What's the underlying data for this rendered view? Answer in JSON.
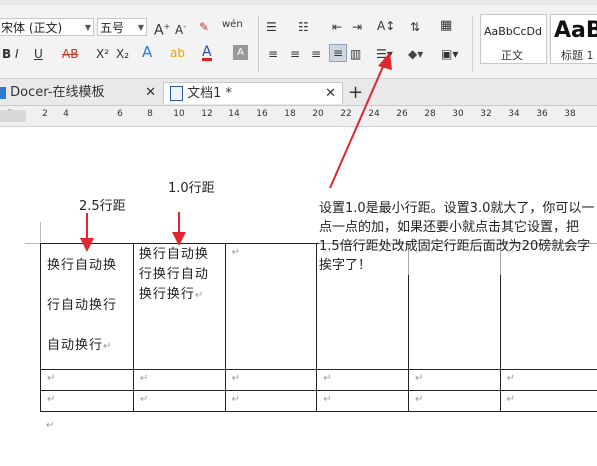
{
  "ribbon": {
    "font_name": "宋体 (正文)",
    "font_size": "五号",
    "style_previews": [
      {
        "sample": "AaBbCcDd",
        "label": "正文"
      },
      {
        "sample": "AaB",
        "label": "标题 1"
      }
    ]
  },
  "tabs": [
    {
      "label": "Docer-在线模板",
      "close": "✕"
    },
    {
      "label": "文档1 *",
      "close": "✕"
    }
  ],
  "new_tab": "+",
  "ruler": {
    "numbers": [
      "2",
      "2",
      "4",
      "6",
      "8",
      "10",
      "12",
      "14",
      "16",
      "18",
      "20",
      "22",
      "24",
      "26",
      "28",
      "30",
      "32",
      "34",
      "36",
      "38"
    ]
  },
  "annotations": {
    "label_25": "2.5行距",
    "label_10": "1.0行距",
    "note": "设置1.0是最小行距。设置3.0就大了，你可以一点一点的加，如果还要小就点击其它设置，把1.5倍行距处改成固定行距后面改为20磅就会字挨字了！"
  },
  "table": {
    "cell_25_lines": [
      "换行自动换",
      "行自动换行",
      "自动换行"
    ],
    "cell_10_lines": [
      "换行自动换",
      "行换行自动",
      "换行换行"
    ],
    "para_mark": "↵"
  },
  "colors": {
    "arrow": "#e0262e",
    "accent": "#2b579a"
  }
}
